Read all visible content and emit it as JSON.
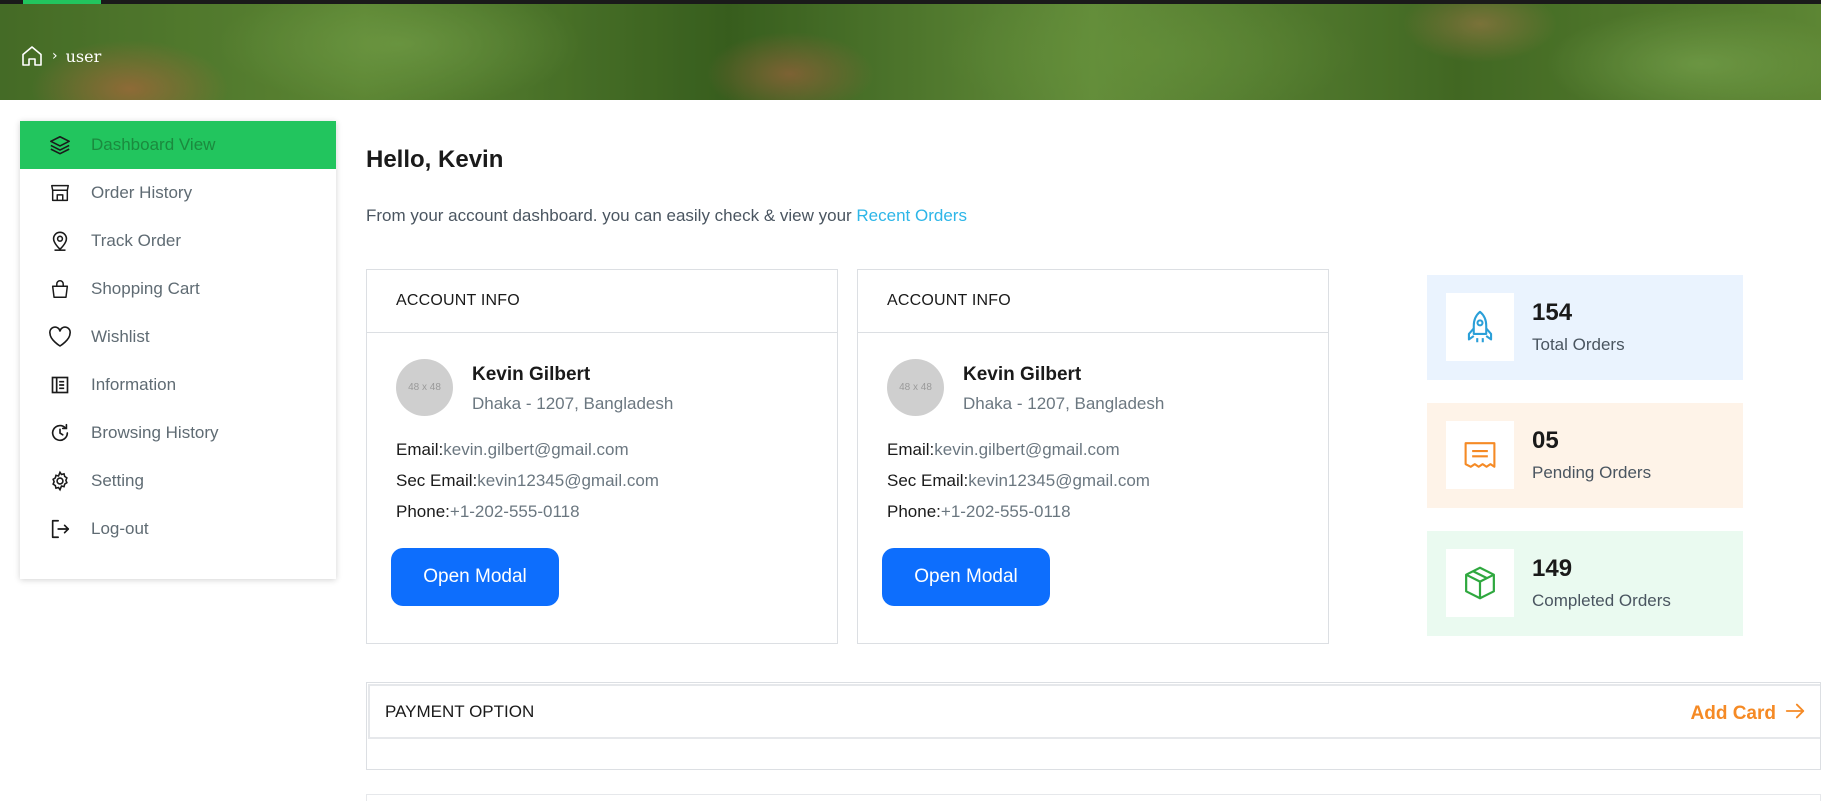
{
  "breadcrumb": {
    "home_icon": "home-icon",
    "separator": "›",
    "current": "user"
  },
  "sidebar": {
    "items": [
      {
        "label": "Dashboard View",
        "icon": "layers-icon",
        "active": true
      },
      {
        "label": "Order History",
        "icon": "storefront-icon"
      },
      {
        "label": "Track Order",
        "icon": "map-pin-icon"
      },
      {
        "label": "Shopping Cart",
        "icon": "shopping-bag-icon"
      },
      {
        "label": "Wishlist",
        "icon": "heart-icon"
      },
      {
        "label": "Information",
        "icon": "document-icon"
      },
      {
        "label": "Browsing History",
        "icon": "history-icon"
      },
      {
        "label": "Setting",
        "icon": "gear-icon"
      },
      {
        "label": "Log-out",
        "icon": "logout-icon"
      }
    ]
  },
  "main": {
    "greeting": "Hello, Kevin",
    "intro_text": "From your account dashboard. you can easily check & view your ",
    "intro_link": "Recent Orders",
    "cards": [
      {
        "title": "ACCOUNT INFO",
        "avatar_placeholder": "48 x 48",
        "name": "Kevin Gilbert",
        "address": "Dhaka - 1207, Bangladesh",
        "email_label": "Email:",
        "email": "kevin.gilbert@gmail.com",
        "sec_email_label": "Sec Email:",
        "sec_email": "kevin12345@gmail.com",
        "phone_label": "Phone:",
        "phone": "+1-202-555-0118",
        "button": "Open Modal"
      },
      {
        "title": "ACCOUNT INFO",
        "avatar_placeholder": "48 x 48",
        "name": "Kevin Gilbert",
        "address": "Dhaka - 1207, Bangladesh",
        "email_label": "Email:",
        "email": "kevin.gilbert@gmail.com",
        "sec_email_label": "Sec Email:",
        "sec_email": "kevin12345@gmail.com",
        "phone_label": "Phone:",
        "phone": "+1-202-555-0118",
        "button": "Open Modal"
      }
    ],
    "stats": [
      {
        "value": "154",
        "label": "Total Orders",
        "icon": "rocket-icon",
        "bg": "#eaf3fe",
        "color": "#2a9fd8"
      },
      {
        "value": "05",
        "label": "Pending Orders",
        "icon": "receipt-icon",
        "bg": "#fef3e8",
        "color": "#f58a25"
      },
      {
        "value": "149",
        "label": "Completed Orders",
        "icon": "package-icon",
        "bg": "#eafaf0",
        "color": "#2fa83f"
      }
    ],
    "payment": {
      "title": "PAYMENT OPTION",
      "add_label": "Add Card"
    }
  },
  "colors": {
    "accent": "#22c55e",
    "primary_button": "#0d6efd",
    "link": "#2db6e8",
    "add_card": "#f58a25"
  }
}
